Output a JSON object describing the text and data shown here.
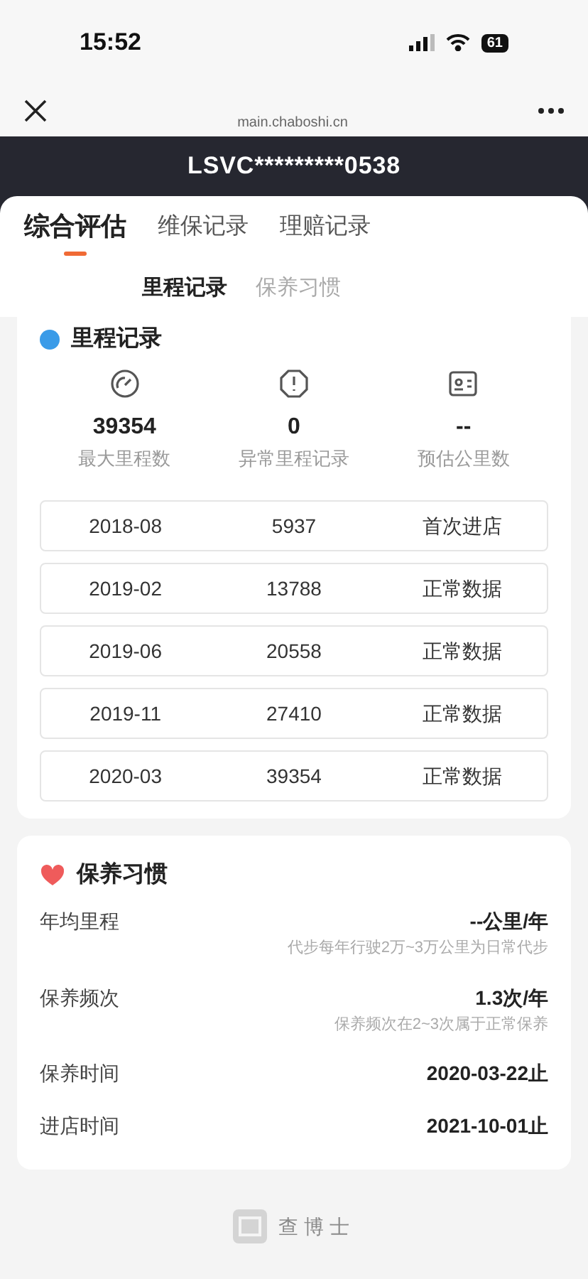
{
  "status_bar": {
    "time": "15:52",
    "battery": "61"
  },
  "browser": {
    "url": "main.chaboshi.cn"
  },
  "vin": "LSVC*********0538",
  "tabs": [
    {
      "label": "综合评估",
      "selected": true
    },
    {
      "label": "维保记录",
      "selected": false
    },
    {
      "label": "理赔记录",
      "selected": false
    }
  ],
  "sub_tabs": [
    {
      "label": "里程记录",
      "selected": true
    },
    {
      "label": "保养习惯",
      "selected": false
    }
  ],
  "mileage": {
    "title": "里程记录",
    "stats": [
      {
        "kind": "gauge",
        "value": "39354",
        "label": "最大里程数"
      },
      {
        "kind": "alert",
        "value": "0",
        "label": "异常里程记录"
      },
      {
        "kind": "card",
        "value": "--",
        "label": "预估公里数"
      }
    ],
    "rows": [
      {
        "date": "2018-08",
        "km": "5937",
        "status": "首次进店"
      },
      {
        "date": "2019-02",
        "km": "13788",
        "status": "正常数据"
      },
      {
        "date": "2019-06",
        "km": "20558",
        "status": "正常数据"
      },
      {
        "date": "2019-11",
        "km": "27410",
        "status": "正常数据"
      },
      {
        "date": "2020-03",
        "km": "39354",
        "status": "正常数据"
      }
    ]
  },
  "habits": {
    "title": "保养习惯",
    "items": [
      {
        "label": "年均里程",
        "value": "--公里/年",
        "note": "代步每年行驶2万~3万公里为日常代步"
      },
      {
        "label": "保养频次",
        "value": "1.3次/年",
        "note": "保养频次在2~3次属于正常保养"
      },
      {
        "label": "保养时间",
        "value": "2020-03-22止"
      },
      {
        "label": "进店时间",
        "value": "2021-10-01止"
      }
    ]
  },
  "footer": {
    "brand": "查博士"
  }
}
